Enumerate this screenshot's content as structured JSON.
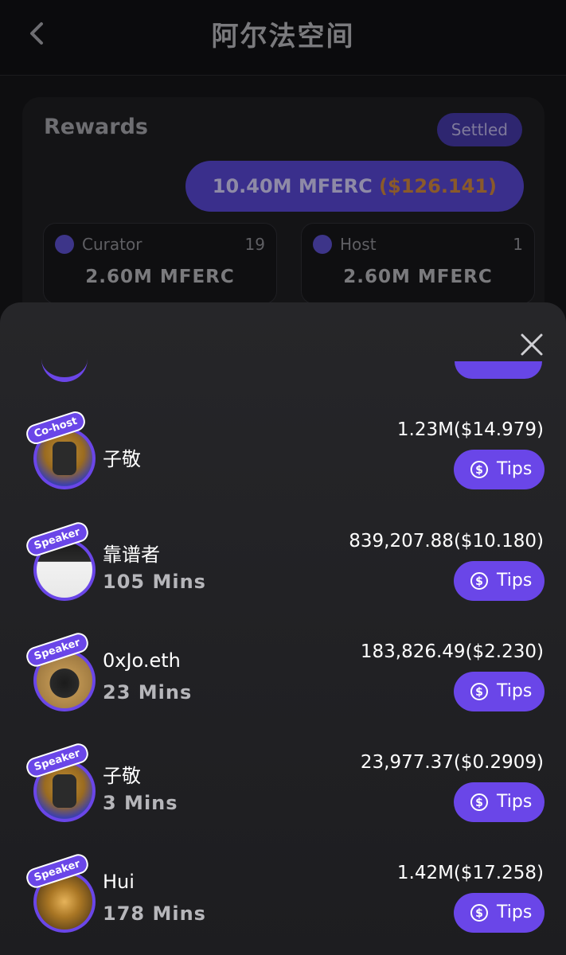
{
  "header": {
    "title": "阿尔法空间"
  },
  "rewards": {
    "title": "Rewards",
    "status": "Settled",
    "total_amount": "10.40M MFERC",
    "total_usd": "($126.141)",
    "curator": {
      "label": "Curator",
      "count": "19",
      "amount": "2.60M MFERC"
    },
    "host": {
      "label": "Host",
      "count": "1",
      "amount": "2.60M MFERC"
    }
  },
  "sheet": {
    "tips_label": "Tips",
    "rows": [
      {
        "role": "Co-host",
        "name": "子敬",
        "mins": "",
        "amount": "1.23M($14.979)"
      },
      {
        "role": "Speaker",
        "name": "靠谱者",
        "mins": "105 Mins",
        "amount": "839,207.88($10.180)"
      },
      {
        "role": "Speaker",
        "name": "0xJo.eth",
        "mins": "23 Mins",
        "amount": "183,826.49($2.230)"
      },
      {
        "role": "Speaker",
        "name": "子敬",
        "mins": "3 Mins",
        "amount": "23,977.37($0.2909)"
      },
      {
        "role": "Speaker",
        "name": "Hui",
        "mins": "178 Mins",
        "amount": "1.42M($17.258)"
      }
    ]
  },
  "colors": {
    "accent": "#6a46e8",
    "background": "#0e0e10",
    "sheet": "#232326"
  }
}
